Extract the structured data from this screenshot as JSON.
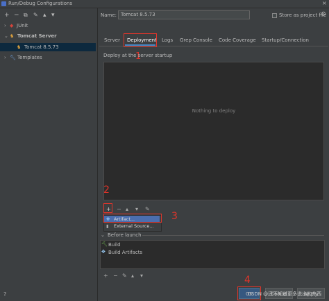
{
  "window": {
    "title": "Run/Debug Configurations",
    "close": "×"
  },
  "toolbar": {
    "add": "+",
    "remove": "−",
    "copy": "⧉",
    "edit": "✎",
    "up": "▴",
    "down": "▾"
  },
  "tree": [
    {
      "label": "JUnit",
      "expanded": false
    },
    {
      "label": "Tomcat Server",
      "expanded": true
    },
    {
      "label": "Tomcat 8.5.73",
      "selected": true
    },
    {
      "label": "Templates",
      "expanded": false
    }
  ],
  "name": {
    "label": "Name:",
    "value": "Tomcat 8.5.73"
  },
  "store": {
    "label": "Store as project file",
    "checked": false
  },
  "tabs": [
    "Server",
    "Deployment",
    "Logs",
    "Grep Console",
    "Code Coverage",
    "Startup/Connection"
  ],
  "active_tab": "Deployment",
  "deployment": {
    "label": "Deploy at the server startup",
    "empty_text": "Nothing to deploy"
  },
  "popup": {
    "items": [
      "Artifact...",
      "External Source..."
    ]
  },
  "before_launch": {
    "label": "Before launch",
    "items": [
      "Build",
      "Build Artifacts"
    ]
  },
  "annotations": [
    "1",
    "2",
    "3",
    "4"
  ],
  "footer": {
    "help": "?",
    "ok": "OK",
    "cancel": "Cancel",
    "apply": "Apply",
    "watermark": "CSDN @还不知道更多说出的东西"
  },
  "colors": {
    "annotation": "#e0352b",
    "selection": "#0d293e",
    "popup_selection": "#4b6eaf"
  }
}
